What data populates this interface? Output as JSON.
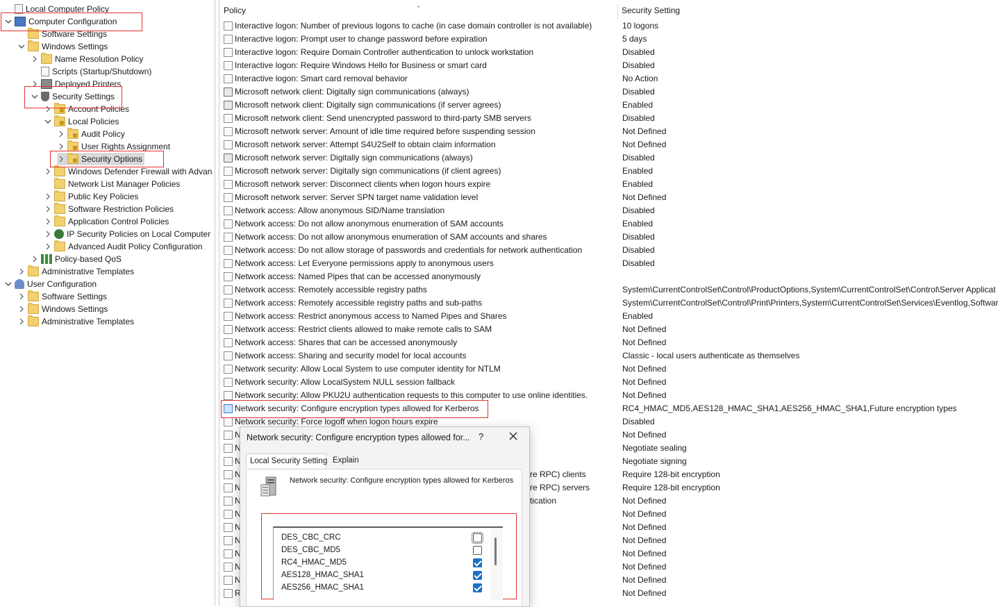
{
  "tree": {
    "items": [
      {
        "label": "Local Computer Policy",
        "indent": 0,
        "chevron": "",
        "icon": "document-icon"
      },
      {
        "label": "Computer Configuration",
        "indent": 0,
        "chevron": "down",
        "icon": "computer-icon"
      },
      {
        "label": "Software Settings",
        "indent": 1,
        "chevron": "",
        "icon": "folder-icon"
      },
      {
        "label": "Windows Settings",
        "indent": 1,
        "chevron": "down",
        "icon": "folder-icon"
      },
      {
        "label": "Name Resolution Policy",
        "indent": 2,
        "chevron": "right",
        "icon": "folder-icon"
      },
      {
        "label": "Scripts (Startup/Shutdown)",
        "indent": 2,
        "chevron": "",
        "icon": "scripts-icon"
      },
      {
        "label": "Deployed Printers",
        "indent": 2,
        "chevron": "right",
        "icon": "printer-icon"
      },
      {
        "label": "Security Settings",
        "indent": 2,
        "chevron": "down",
        "icon": "security-settings-icon"
      },
      {
        "label": "Account Policies",
        "indent": 3,
        "chevron": "right",
        "icon": "lock-folder-icon"
      },
      {
        "label": "Local Policies",
        "indent": 3,
        "chevron": "down",
        "icon": "lock-folder-icon"
      },
      {
        "label": "Audit Policy",
        "indent": 4,
        "chevron": "right",
        "icon": "lock-folder-icon"
      },
      {
        "label": "User Rights Assignment",
        "indent": 4,
        "chevron": "right",
        "icon": "lock-folder-icon"
      },
      {
        "label": "Security Options",
        "indent": 4,
        "chevron": "right",
        "icon": "lock-folder-icon"
      },
      {
        "label": "Windows Defender Firewall with Advan",
        "indent": 3,
        "chevron": "right",
        "icon": "folder-icon"
      },
      {
        "label": "Network List Manager Policies",
        "indent": 3,
        "chevron": "",
        "icon": "folder-icon"
      },
      {
        "label": "Public Key Policies",
        "indent": 3,
        "chevron": "right",
        "icon": "folder-icon"
      },
      {
        "label": "Software Restriction Policies",
        "indent": 3,
        "chevron": "right",
        "icon": "folder-icon"
      },
      {
        "label": "Application Control Policies",
        "indent": 3,
        "chevron": "right",
        "icon": "folder-icon"
      },
      {
        "label": "IP Security Policies on Local Computer",
        "indent": 3,
        "chevron": "right",
        "icon": "ip-security-icon"
      },
      {
        "label": "Advanced Audit Policy Configuration",
        "indent": 3,
        "chevron": "right",
        "icon": "folder-icon"
      },
      {
        "label": "Policy-based QoS",
        "indent": 2,
        "chevron": "right",
        "icon": "qos-icon"
      },
      {
        "label": "Administrative Templates",
        "indent": 1,
        "chevron": "right",
        "icon": "folder-icon"
      },
      {
        "label": "User Configuration",
        "indent": 0,
        "chevron": "down",
        "icon": "user-icon"
      },
      {
        "label": "Software Settings",
        "indent": 1,
        "chevron": "right",
        "icon": "folder-icon"
      },
      {
        "label": "Windows Settings",
        "indent": 1,
        "chevron": "right",
        "icon": "folder-icon"
      },
      {
        "label": "Administrative Templates",
        "indent": 1,
        "chevron": "right",
        "icon": "folder-icon"
      }
    ]
  },
  "list": {
    "columns": {
      "policy": "Policy",
      "setting": "Security Setting"
    },
    "rows": [
      {
        "policy": "Interactive logon: Number of previous logons to cache (in case domain controller is not available)",
        "setting": "10 logons"
      },
      {
        "policy": "Interactive logon: Prompt user to change password before expiration",
        "setting": "5 days"
      },
      {
        "policy": "Interactive logon: Require Domain Controller authentication to unlock workstation",
        "setting": "Disabled"
      },
      {
        "policy": "Interactive logon: Require Windows Hello for Business or smart card",
        "setting": "Disabled"
      },
      {
        "policy": "Interactive logon: Smart card removal behavior",
        "setting": "No Action"
      },
      {
        "policy": "Microsoft network client: Digitally sign communications (always)",
        "setting": "Disabled"
      },
      {
        "policy": "Microsoft network client: Digitally sign communications (if server agrees)",
        "setting": "Enabled"
      },
      {
        "policy": "Microsoft network client: Send unencrypted password to third-party SMB servers",
        "setting": "Disabled"
      },
      {
        "policy": "Microsoft network server: Amount of idle time required before suspending session",
        "setting": "Not Defined"
      },
      {
        "policy": "Microsoft network server: Attempt S4U2Self to obtain claim information",
        "setting": "Not Defined"
      },
      {
        "policy": "Microsoft network server: Digitally sign communications (always)",
        "setting": "Disabled"
      },
      {
        "policy": "Microsoft network server: Digitally sign communications (if client agrees)",
        "setting": "Enabled"
      },
      {
        "policy": "Microsoft network server: Disconnect clients when logon hours expire",
        "setting": "Enabled"
      },
      {
        "policy": "Microsoft network server: Server SPN target name validation level",
        "setting": "Not Defined"
      },
      {
        "policy": "Network access: Allow anonymous SID/Name translation",
        "setting": "Disabled"
      },
      {
        "policy": "Network access: Do not allow anonymous enumeration of SAM accounts",
        "setting": "Enabled"
      },
      {
        "policy": "Network access: Do not allow anonymous enumeration of SAM accounts and shares",
        "setting": "Disabled"
      },
      {
        "policy": "Network access: Do not allow storage of passwords and credentials for network authentication",
        "setting": "Disabled"
      },
      {
        "policy": "Network access: Let Everyone permissions apply to anonymous users",
        "setting": "Disabled"
      },
      {
        "policy": "Network access: Named Pipes that can be accessed anonymously",
        "setting": ""
      },
      {
        "policy": "Network access: Remotely accessible registry paths",
        "setting": "System\\CurrentControlSet\\Control\\ProductOptions,System\\CurrentControlSet\\Control\\Server Applicat"
      },
      {
        "policy": "Network access: Remotely accessible registry paths and sub-paths",
        "setting": "System\\CurrentControlSet\\Control\\Print\\Printers,System\\CurrentControlSet\\Services\\Eventlog,Softwar"
      },
      {
        "policy": "Network access: Restrict anonymous access to Named Pipes and Shares",
        "setting": "Enabled"
      },
      {
        "policy": "Network access: Restrict clients allowed to make remote calls to SAM",
        "setting": "Not Defined"
      },
      {
        "policy": "Network access: Shares that can be accessed anonymously",
        "setting": "Not Defined"
      },
      {
        "policy": "Network access: Sharing and security model for local accounts",
        "setting": "Classic - local users authenticate as themselves"
      },
      {
        "policy": "Network security: Allow Local System to use computer identity for NTLM",
        "setting": "Not Defined"
      },
      {
        "policy": "Network security: Allow LocalSystem NULL session fallback",
        "setting": "Not Defined"
      },
      {
        "policy": "Network security: Allow PKU2U authentication requests to this computer to use online identities.",
        "setting": "Not Defined"
      },
      {
        "policy": "Network security: Configure encryption types allowed for Kerberos",
        "setting": "RC4_HMAC_MD5,AES128_HMAC_SHA1,AES256_HMAC_SHA1,Future encryption types"
      },
      {
        "policy": "Network security: Force logoff when logon hours expire",
        "setting": "Disabled"
      },
      {
        "policy": "N",
        "setting": "Not Defined"
      },
      {
        "policy": "N",
        "setting": "Negotiate sealing"
      },
      {
        "policy": "N",
        "setting": "Negotiate signing"
      },
      {
        "policy": "N",
        "setting": "Require 128-bit encryption",
        "tail": "re RPC) clients"
      },
      {
        "policy": "N",
        "setting": "Require 128-bit encryption",
        "tail": "re RPC) servers"
      },
      {
        "policy": "N",
        "setting": "Not Defined",
        "tail": "tication"
      },
      {
        "policy": "N",
        "setting": "Not Defined"
      },
      {
        "policy": "N",
        "setting": "Not Defined"
      },
      {
        "policy": "N",
        "setting": "Not Defined"
      },
      {
        "policy": "N",
        "setting": "Not Defined"
      },
      {
        "policy": "N",
        "setting": "Not Defined"
      },
      {
        "policy": "N",
        "setting": "Not Defined"
      },
      {
        "policy": "R",
        "setting": "Not Defined"
      }
    ]
  },
  "dialog": {
    "title": "Network security: Configure encryption types allowed for...",
    "help": "?",
    "tabs": [
      "Local Security Setting",
      "Explain"
    ],
    "policy_name": "Network security: Configure encryption types allowed for Kerberos",
    "encryption_types": [
      {
        "label": "DES_CBC_CRC",
        "checked": false
      },
      {
        "label": "DES_CBC_MD5",
        "checked": false
      },
      {
        "label": "RC4_HMAC_MD5",
        "checked": true
      },
      {
        "label": "AES128_HMAC_SHA1",
        "checked": true
      },
      {
        "label": "AES256_HMAC_SHA1",
        "checked": true
      }
    ]
  }
}
